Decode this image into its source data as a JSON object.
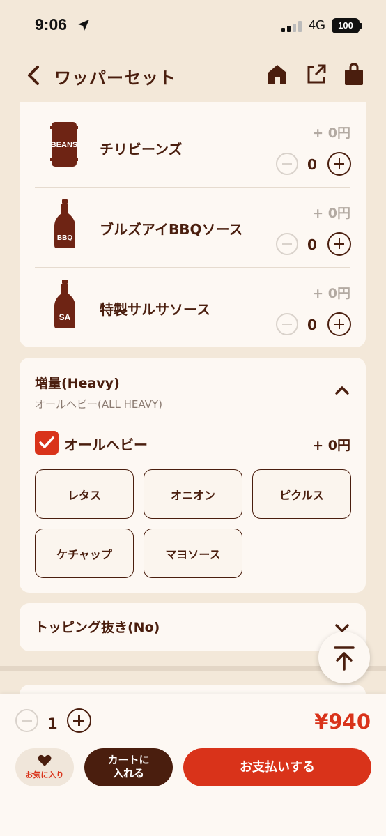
{
  "status_bar": {
    "time": "9:06",
    "network": "4G",
    "battery": "100"
  },
  "header": {
    "title": "ワッパーセット",
    "icons": [
      "back-icon",
      "home-icon",
      "share-icon",
      "bag-icon"
    ]
  },
  "sauce_items": [
    {
      "name": "チリビーンズ",
      "price": "+ 0円",
      "qty": "0",
      "label": "BEANS"
    },
    {
      "name": "ブルズアイBBQソース",
      "price": "+ 0円",
      "qty": "0",
      "label": "BBQ"
    },
    {
      "name": "特製サルサソース",
      "price": "+ 0円",
      "qty": "0",
      "label": "SA"
    }
  ],
  "heavy": {
    "title": "増量(Heavy)",
    "subtitle": "オールヘビー(ALL HEAVY)",
    "check_label": "オールヘビー",
    "check_price": "+ 0円",
    "options": [
      "レタス",
      "オニオン",
      "ピクルス",
      "ケチャップ",
      "マヨソース"
    ]
  },
  "no_topping": {
    "title": "トッピング抜き(No)"
  },
  "footer": {
    "qty": "1",
    "total": "¥940",
    "favorite_label": "お気に入り",
    "cart_label_1": "カートに",
    "cart_label_2": "入れる",
    "pay_label": "お支払いする"
  },
  "colors": {
    "brown": "#4a1e0e",
    "red": "#d9331a",
    "background": "#f3e8d9",
    "card": "#fdf8f3"
  }
}
